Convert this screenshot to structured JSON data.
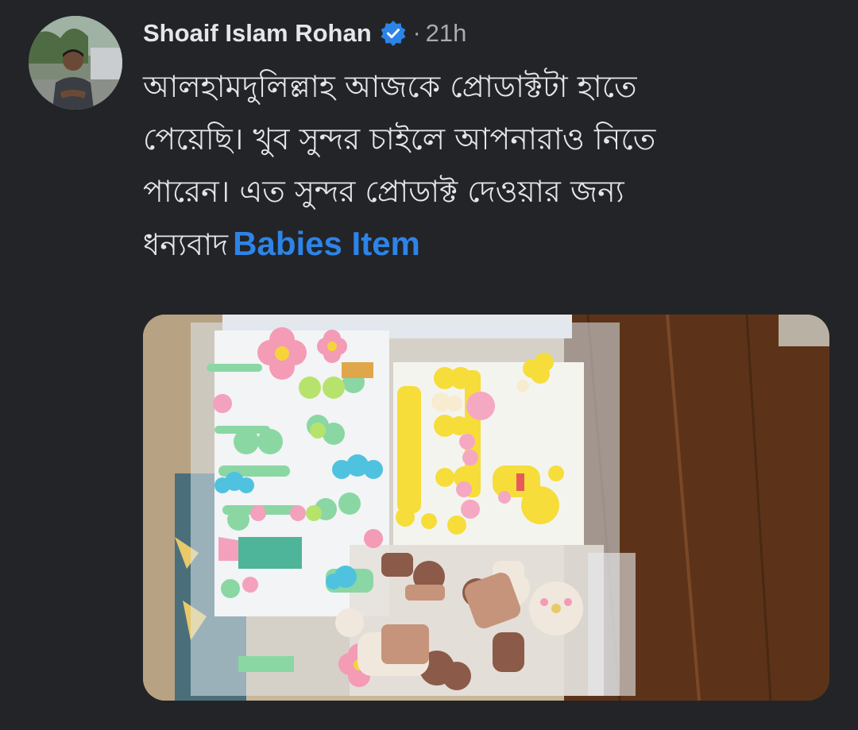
{
  "post": {
    "author": {
      "name": "Shoaif Islam Rohan",
      "verified": true,
      "avatar_icon": "profile-photo"
    },
    "separator": "·",
    "timestamp": "21h",
    "text_lines": [
      "আলহামদুলিল্লাহ আজকে প্রোডাক্টটা হাতে",
      "পেয়েছি। খুব সুন্দর চাইলে আপনারাও নিতে",
      "পারেন।  এত সুন্দর প্রোডাক্ট দেওয়ার জন্য",
      "ধন্যবাদ"
    ],
    "tagged_page": "Babies Item",
    "link_color": "#2d84e8",
    "photo_icon": "post-photo-hair-clips"
  },
  "colors": {
    "background": "#232427",
    "text": "#e4e6eb",
    "muted": "#a8abb0",
    "verified_badge": "#2d84e8"
  }
}
